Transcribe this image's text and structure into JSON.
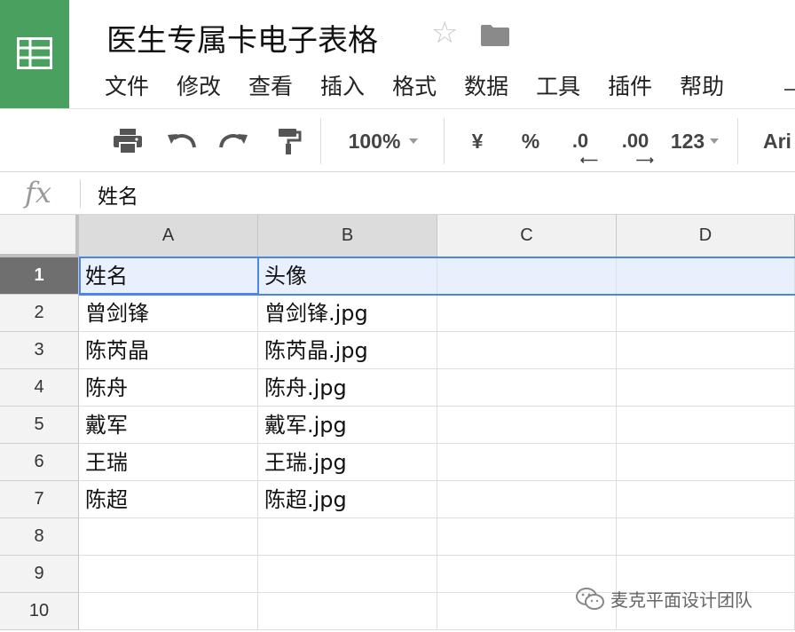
{
  "app": {
    "doc_title": "医生专属卡电子表格"
  },
  "menu": [
    "文件",
    "修改",
    "查看",
    "插入",
    "格式",
    "数据",
    "工具",
    "插件",
    "帮助"
  ],
  "toolbar": {
    "zoom": "100%",
    "currency": "¥",
    "percent": "%",
    "decrease_decimals": ".0",
    "increase_decimals": ".00",
    "more_formats": "123",
    "font": "Ari"
  },
  "formula_bar": {
    "fx_label": "fx",
    "value": "姓名"
  },
  "grid": {
    "columns": [
      "A",
      "B",
      "C",
      "D"
    ],
    "rows": [
      "1",
      "2",
      "3",
      "4",
      "5",
      "6",
      "7",
      "8",
      "9",
      "10"
    ],
    "cells": [
      [
        "姓名",
        "头像",
        "",
        ""
      ],
      [
        "曾剑锋",
        "曾剑锋.jpg",
        "",
        ""
      ],
      [
        "陈芮晶",
        "陈芮晶.jpg",
        "",
        ""
      ],
      [
        "陈舟",
        "陈舟.jpg",
        "",
        ""
      ],
      [
        "戴军",
        "戴军.jpg",
        "",
        ""
      ],
      [
        "王瑞",
        "王瑞.jpg",
        "",
        ""
      ],
      [
        "陈超",
        "陈超.jpg",
        "",
        ""
      ],
      [
        "",
        "",
        "",
        ""
      ],
      [
        "",
        "",
        "",
        ""
      ],
      [
        "",
        "",
        "",
        ""
      ]
    ],
    "selected_row": "1",
    "active_cell": "A1"
  },
  "watermark": {
    "text": "麦克平面设计团队"
  },
  "colors": {
    "brand_green": "#49a05f",
    "selection_blue": "#4a86e8",
    "row_highlight": "#e8f0fe"
  }
}
